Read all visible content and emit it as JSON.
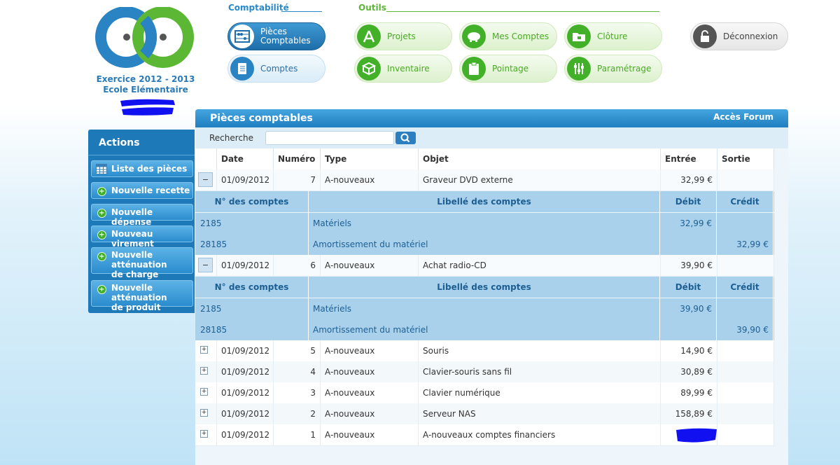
{
  "header": {
    "exercise": "Exercice 2012 - 2013",
    "school": "Ecole Elémentaire",
    "colors": {
      "blue": "#2a83c2",
      "green": "#5bb734"
    }
  },
  "nav": {
    "comptabilite_label": "Comptabilité",
    "outils_label": "Outils",
    "pieces_line1": "Pièces",
    "pieces_line2": "Comptables",
    "comptes": "Comptes",
    "projets": "Projets",
    "mes_comptes": "Mes Comptes",
    "cloture": "Clôture",
    "inventaire": "Inventaire",
    "pointage": "Pointage",
    "parametrage": "Paramétrage",
    "deconnexion": "Déconnexion"
  },
  "actions": {
    "title": "Actions",
    "liste": "Liste des pièces",
    "recette": "Nouvelle recette",
    "depense": "Nouvelle dépense",
    "virement": "Nouveau virement",
    "attenuation_charge_1": "Nouvelle atténuation",
    "attenuation_charge_2": "de charge",
    "attenuation_produit_1": "Nouvelle atténuation",
    "attenuation_produit_2": "de produit"
  },
  "main": {
    "title": "Pièces comptables",
    "forum": "Accès Forum",
    "search_label": "Recherche",
    "search_value": ""
  },
  "table": {
    "headers": {
      "date": "Date",
      "numero": "Numéro",
      "type": "Type",
      "objet": "Objet",
      "entree": "Entrée",
      "sortie": "Sortie"
    },
    "sub_headers": {
      "compte": "N° des comptes",
      "libelle": "Libellé des comptes",
      "debit": "Débit",
      "credit": "Crédit"
    },
    "rows": [
      {
        "date": "01/09/2012",
        "numero": "7",
        "type": "A-nouveaux",
        "objet": "Graveur DVD externe",
        "entree": "32,99 €",
        "sortie": "",
        "lines": [
          {
            "compte": "2185",
            "libelle": "Matériels",
            "debit": "32,99 €",
            "credit": ""
          },
          {
            "compte": "28185",
            "libelle": "Amortissement du matériel",
            "debit": "",
            "credit": "32,99 €"
          }
        ]
      },
      {
        "date": "01/09/2012",
        "numero": "6",
        "type": "A-nouveaux",
        "objet": "Achat radio-CD",
        "entree": "39,90 €",
        "sortie": "",
        "lines": [
          {
            "compte": "2185",
            "libelle": "Matériels",
            "debit": "39,90 €",
            "credit": ""
          },
          {
            "compte": "28185",
            "libelle": "Amortissement du matériel",
            "debit": "",
            "credit": "39,90 €"
          }
        ]
      },
      {
        "date": "01/09/2012",
        "numero": "5",
        "type": "A-nouveaux",
        "objet": "Souris",
        "entree": "14,90 €",
        "sortie": ""
      },
      {
        "date": "01/09/2012",
        "numero": "4",
        "type": "A-nouveaux",
        "objet": "Clavier-souris sans fil",
        "entree": "30,89 €",
        "sortie": ""
      },
      {
        "date": "01/09/2012",
        "numero": "3",
        "type": "A-nouveaux",
        "objet": "Clavier numérique",
        "entree": "89,99 €",
        "sortie": ""
      },
      {
        "date": "01/09/2012",
        "numero": "2",
        "type": "A-nouveaux",
        "objet": "Serveur NAS",
        "entree": "158,89 €",
        "sortie": ""
      },
      {
        "date": "01/09/2012",
        "numero": "1",
        "type": "A-nouveaux",
        "objet": "A-nouveaux comptes financiers",
        "entree": "",
        "sortie": ""
      }
    ]
  }
}
